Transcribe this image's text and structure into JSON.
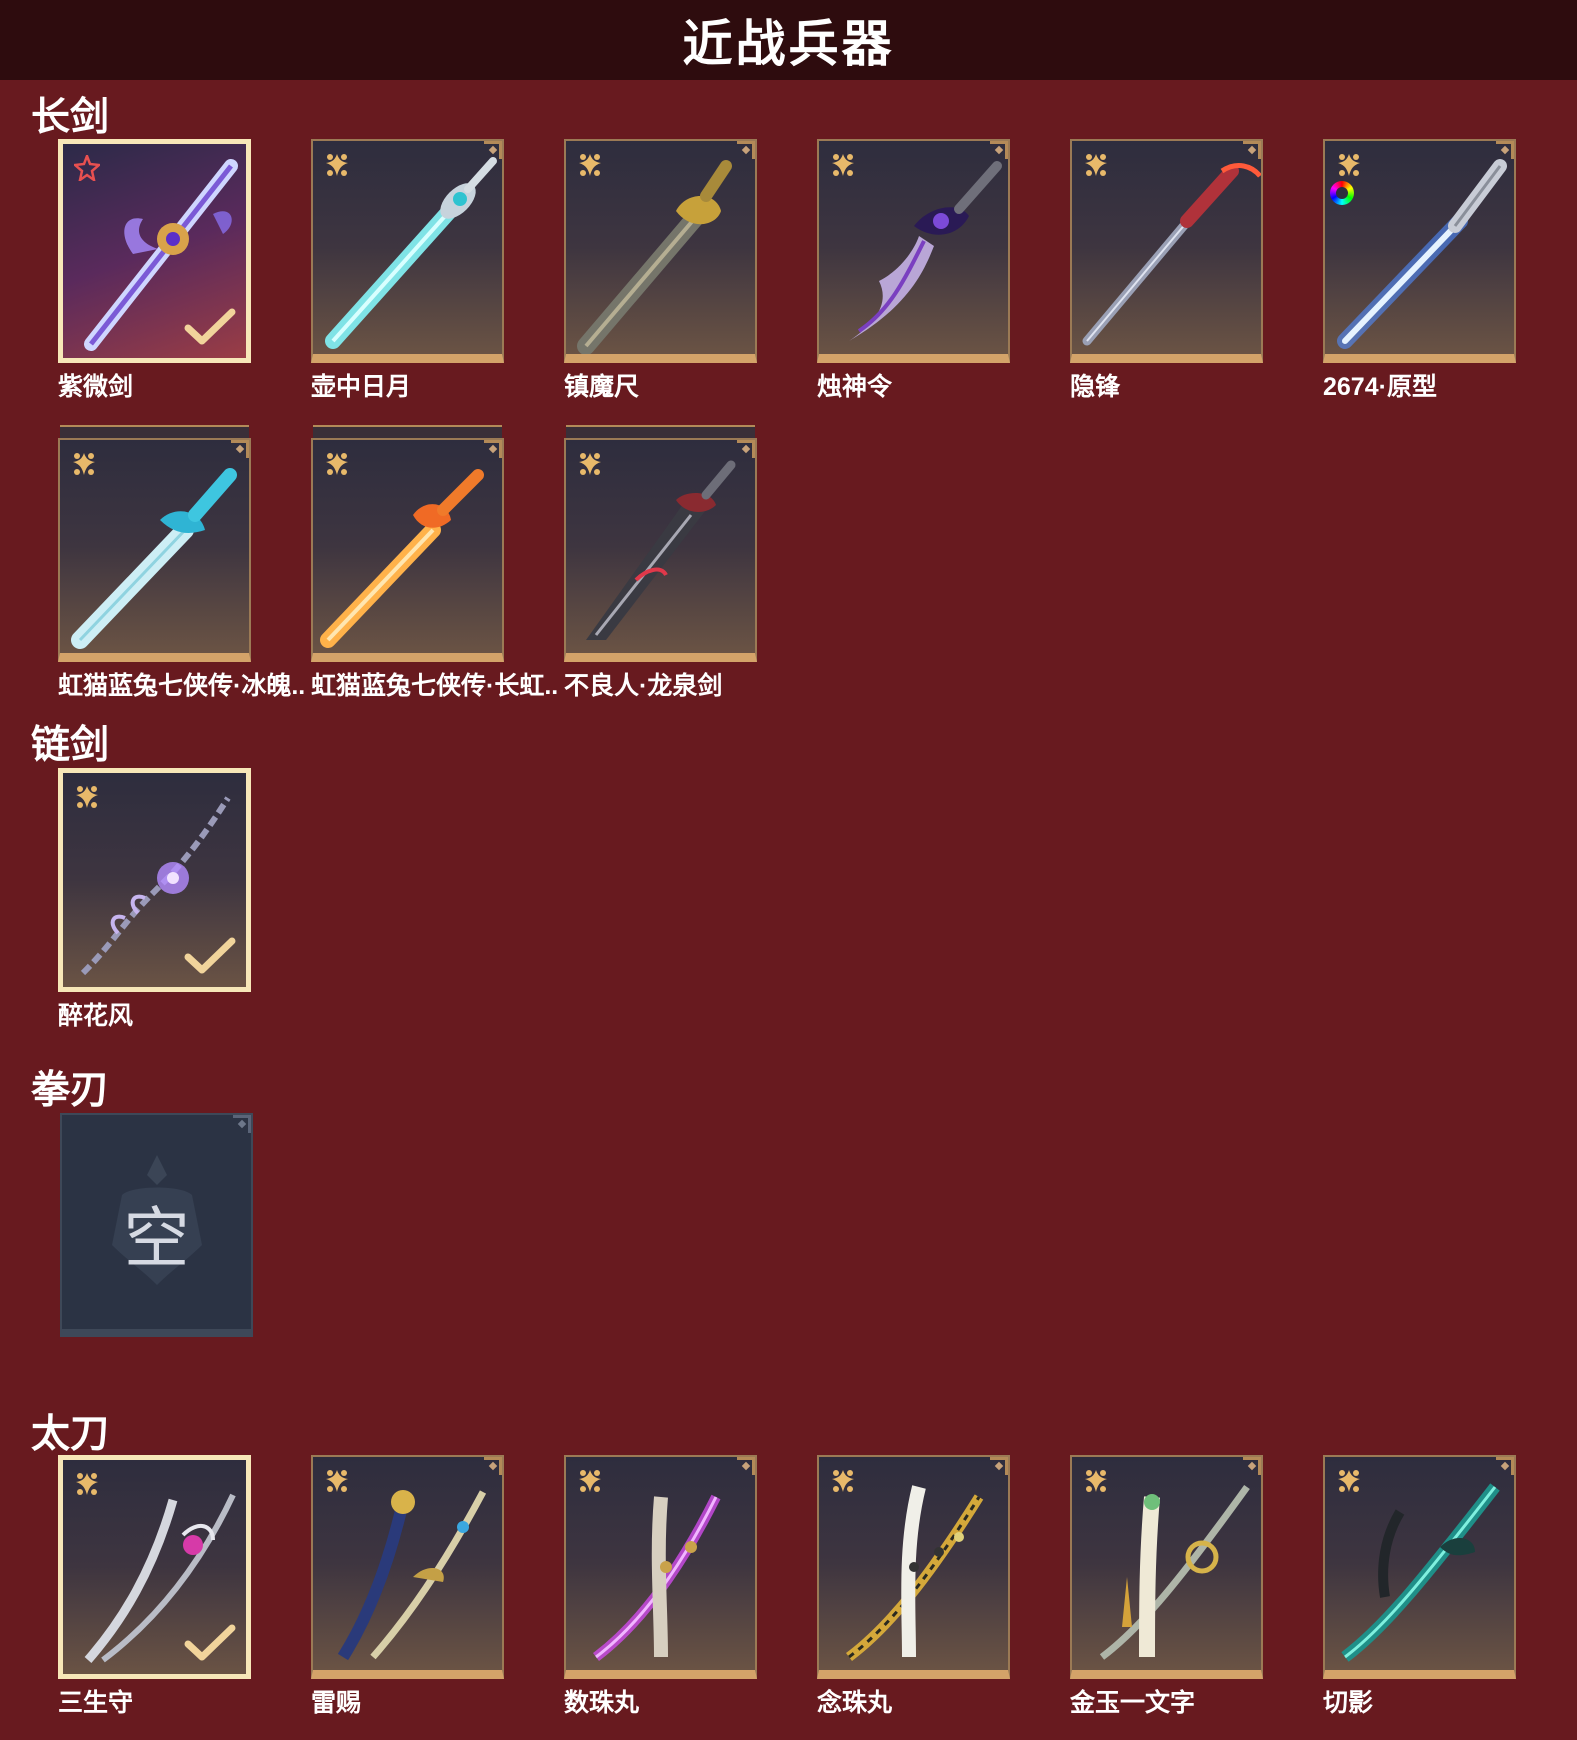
{
  "header": {
    "title": "近战兵器"
  },
  "sections": {
    "changjian": {
      "title": "长剑",
      "items": [
        {
          "label": "紫微剑"
        },
        {
          "label": "壶中日月"
        },
        {
          "label": "镇魔尺"
        },
        {
          "label": "烛神令"
        },
        {
          "label": "隐锋"
        },
        {
          "label": "2674·原型"
        },
        {
          "label": "虹猫蓝兔七侠传·冰魄.."
        },
        {
          "label": "虹猫蓝兔七侠传·长虹.."
        },
        {
          "label": "不良人·龙泉剑"
        }
      ]
    },
    "lianjian": {
      "title": "链剑",
      "items": [
        {
          "label": "醉花风"
        }
      ]
    },
    "quanren": {
      "title": "拳刃",
      "empty_label": "空"
    },
    "taidao": {
      "title": "太刀",
      "items": [
        {
          "label": "三生守"
        },
        {
          "label": "雷赐"
        },
        {
          "label": "数珠丸"
        },
        {
          "label": "念珠丸"
        },
        {
          "label": "金玉一文字"
        },
        {
          "label": "切影"
        }
      ]
    }
  },
  "colors": {
    "background": "#681a1f",
    "header": "#2e0c0e",
    "card_frame": "#d4a369",
    "selected_frame": "#f7e7b8",
    "rarity_gold": "#e8b96a",
    "rarity_red": "#e85050"
  }
}
